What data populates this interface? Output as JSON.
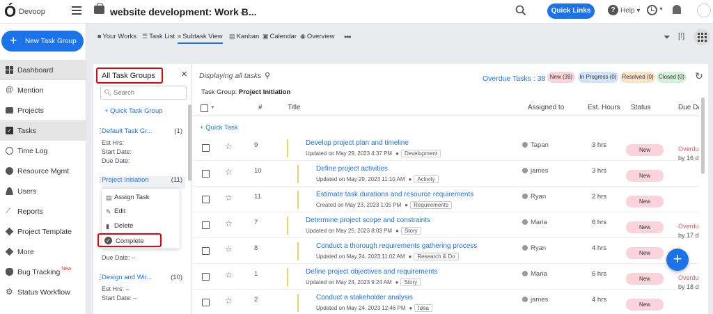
{
  "app": {
    "name": "Devoop",
    "logo": "Ó"
  },
  "header": {
    "project_title": "website development: Work B...",
    "quick_links": "Quick Links",
    "help_label": "Help"
  },
  "sidebar": {
    "new_task_group": "New Task Group",
    "items": [
      {
        "label": "Dashboard",
        "icon": "dashboard-icon"
      },
      {
        "label": "Mention",
        "icon": "at-icon"
      },
      {
        "label": "Projects",
        "icon": "briefcase-icon"
      },
      {
        "label": "Tasks",
        "icon": "checkbox-icon"
      },
      {
        "label": "Time Log",
        "icon": "clock-icon"
      },
      {
        "label": "Resource Mgmt",
        "icon": "resource-icon"
      },
      {
        "label": "Users",
        "icon": "user-icon"
      },
      {
        "label": "Reports",
        "icon": "trend-icon"
      },
      {
        "label": "Project Template",
        "icon": "layers-icon"
      },
      {
        "label": "More",
        "icon": "layers-icon"
      },
      {
        "label": "Bug Tracking",
        "icon": "bug-icon",
        "badge": "New"
      },
      {
        "label": "Status Workflow",
        "icon": "gear-icon"
      }
    ]
  },
  "views": {
    "tabs": [
      {
        "label": "Your Works",
        "icon": "briefcase-icon"
      },
      {
        "label": "Task List",
        "icon": "list-icon"
      },
      {
        "label": "Subtask View",
        "icon": "subtask-icon"
      },
      {
        "label": "Kanban",
        "icon": "kanban-icon"
      },
      {
        "label": "Calendar",
        "icon": "calendar-icon"
      },
      {
        "label": "Overview",
        "icon": "eye-icon"
      }
    ],
    "more": "•••"
  },
  "task_groups": {
    "title": "All Task Groups",
    "search_placeholder": "Search",
    "quick_task_group": "+ Quick Task Group",
    "meta_labels": {
      "est": "Est Hrs:",
      "start": "Start Date:",
      "due": "Due Date:"
    },
    "groups": [
      {
        "name": "Default Task Gr...",
        "count": "(1)"
      },
      {
        "name": "Project Initiation",
        "count": "(11)"
      },
      {
        "name": "Design and Wir...",
        "count": "(10)",
        "est": "Est Hrs: –",
        "start": "Start Date: –"
      }
    ],
    "hidden_due": "Due Date: –",
    "menu": {
      "assign": "Assign Task",
      "edit": "Edit",
      "delete": "Delete",
      "complete": "Complete"
    }
  },
  "tasks": {
    "displaying": "Displaying all tasks",
    "overdue": "Overdue Tasks : 38",
    "badges": [
      {
        "label": "New (39)",
        "color": "#fbd3dd"
      },
      {
        "label": "In Progress (0)",
        "color": "#d3e3fb"
      },
      {
        "label": "Resolved (0)",
        "color": "#fbe3c8"
      },
      {
        "label": "Closed (0)",
        "color": "#d3f0d8"
      }
    ],
    "group_prefix": "Task Group:",
    "group_name": "Project Initiation",
    "columns": {
      "num": "#",
      "title": "Title",
      "assigned": "Assigned to",
      "est": "Est. Hours",
      "status": "Status",
      "due": "Due Date"
    },
    "quick_task": "+ Quick Task",
    "rows": [
      {
        "num": "9",
        "title": "Develop project plan and timeline",
        "meta": "Updated on May 29, 2023 4:37 PM",
        "tag": "Development",
        "user": "Tapan",
        "hrs": "3 hrs",
        "status": "New",
        "overdue": "Overdue",
        "by": "by 16 d"
      },
      {
        "num": "10",
        "title": "Define project activities",
        "meta": "Updated on May 29, 2023 11:10 AM",
        "tag": "Activity",
        "user": "james",
        "hrs": "3 hrs",
        "status": "New",
        "overdue": "",
        "by": ""
      },
      {
        "num": "11",
        "title": "Estimate task durations and resource requirements",
        "meta": "Created on May 23, 2023 1:05 PM",
        "tag": "Requirements",
        "user": "Ryan",
        "hrs": "2 hrs",
        "status": "New",
        "overdue": "",
        "by": ""
      },
      {
        "num": "7",
        "title": "Determine project scope and constraints",
        "meta": "Updated on May 25, 2023 8:03 PM",
        "tag": "Story",
        "user": "Maria",
        "hrs": "6 hrs",
        "status": "New",
        "overdue": "Overdue",
        "by": "by 17 d"
      },
      {
        "num": "8",
        "title": "Conduct a thorough requirements gathering process",
        "meta": "Updated on May 24, 2023 11:02 AM",
        "tag": "Research & Do",
        "user": "Ryan",
        "hrs": "4 hrs",
        "status": "New",
        "overdue": "",
        "by": ""
      },
      {
        "num": "1",
        "title": "Define project objectives and requirements",
        "meta": "Updated on May 24, 2023 9:24 AM",
        "tag": "Story",
        "user": "Maria",
        "hrs": "6 hrs",
        "status": "New",
        "overdue": "Overdue",
        "by": "by 18 d"
      },
      {
        "num": "2",
        "title": "Conduct a stakeholder analysis",
        "meta": "Updated on May 24, 2023 12:46 PM",
        "tag": "Idea",
        "user": "james",
        "hrs": "4 hrs",
        "status": "New",
        "overdue": "",
        "by": ""
      }
    ]
  },
  "fab": "+"
}
